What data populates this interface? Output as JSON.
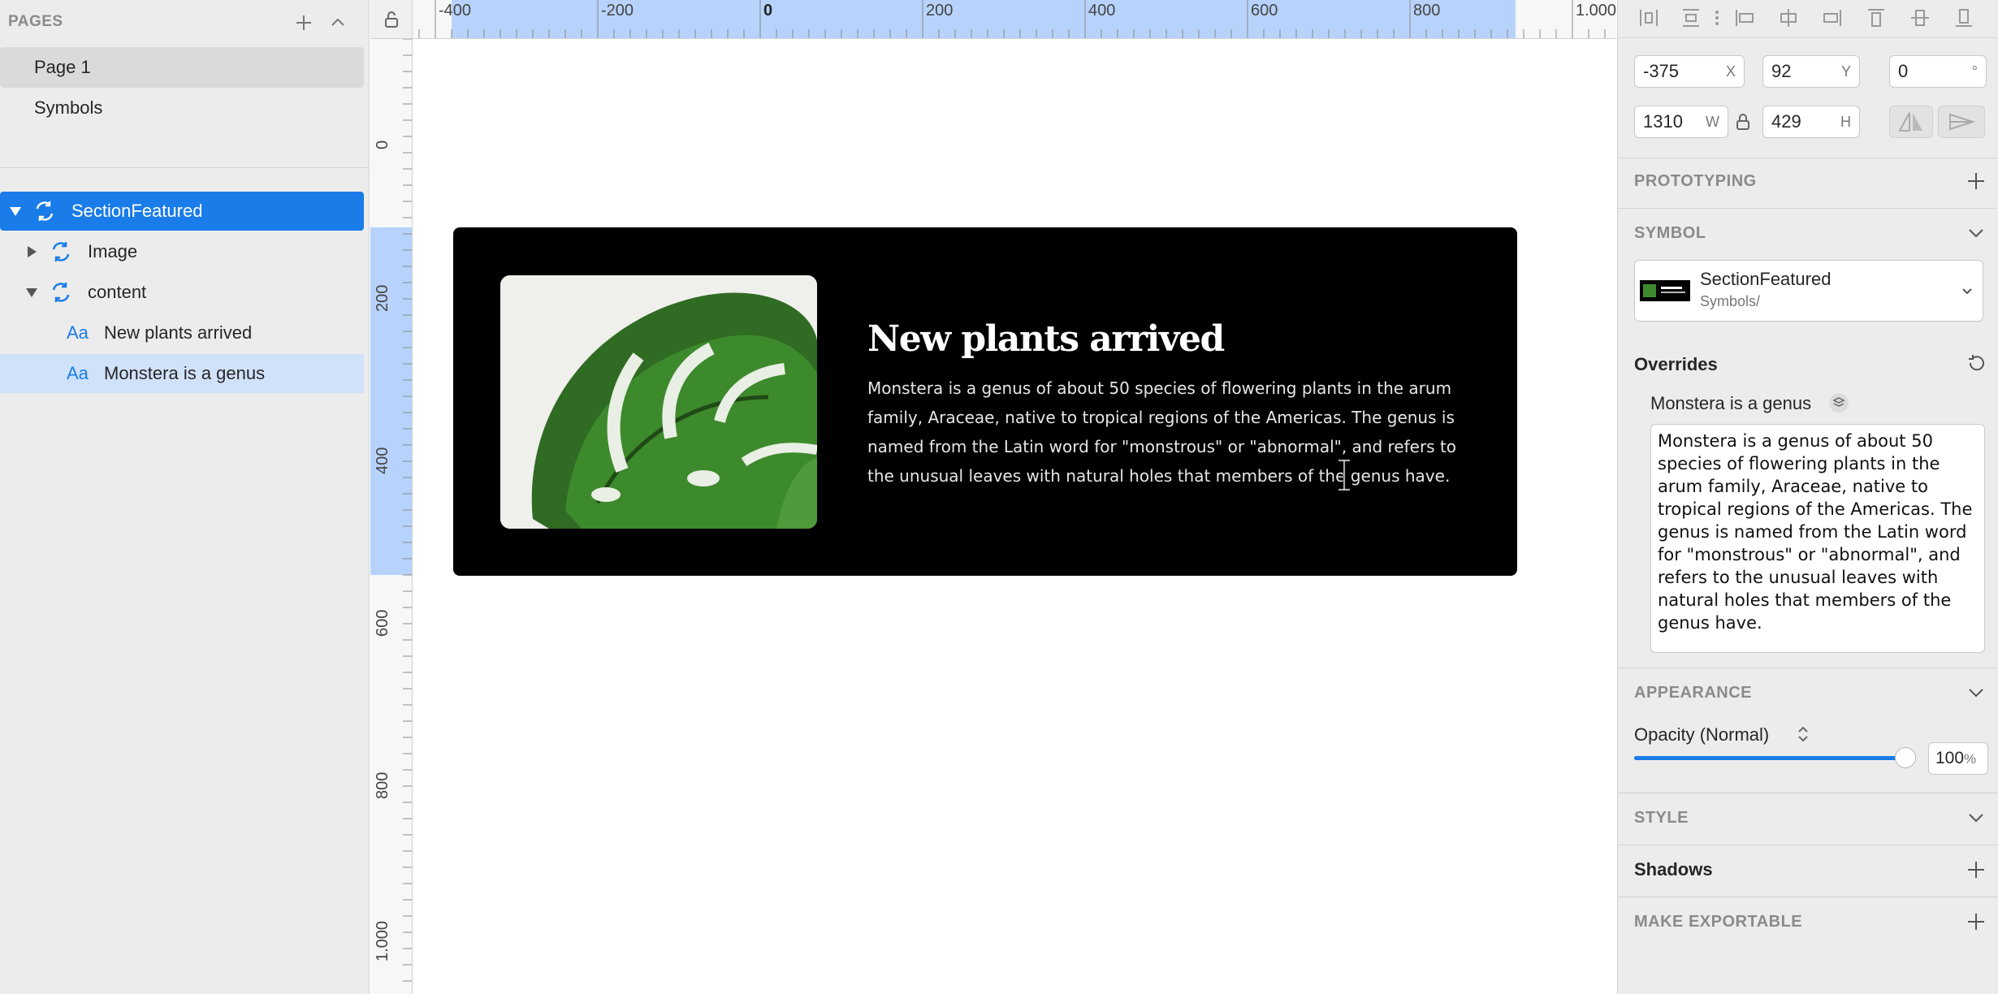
{
  "sidebar": {
    "pages_title": "PAGES",
    "pages": [
      {
        "label": "Page 1"
      },
      {
        "label": "Symbols"
      }
    ],
    "layers": [
      {
        "label": "SectionFeatured"
      },
      {
        "label": "Image"
      },
      {
        "label": "content"
      },
      {
        "label": "New plants arrived",
        "icon_text": "Aa"
      },
      {
        "label": "Monstera is a genus",
        "icon_text": "Aa"
      }
    ]
  },
  "rulers": {
    "top": [
      "-400",
      "-200",
      "0",
      "200",
      "400",
      "600",
      "800",
      "1.000"
    ],
    "left": [
      "0",
      "200",
      "400",
      "600",
      "800",
      "1.000"
    ]
  },
  "artboard": {
    "title": "New plants arrived",
    "body": "Monstera is a genus of about 50 species of flowering plants in the arum family, Araceae, native to tropical regions of the Americas. The genus is named from the Latin word for \"monstrous\" or \"abnormal\", and refers to the unusual leaves with natural holes that members of the genus have."
  },
  "inspector": {
    "x": {
      "value": "-375",
      "suffix": "X"
    },
    "y": {
      "value": "92",
      "suffix": "Y"
    },
    "rotation": {
      "value": "0",
      "suffix": "°"
    },
    "w": {
      "value": "1310",
      "suffix": "W"
    },
    "h": {
      "value": "429",
      "suffix": "H"
    },
    "prototyping_title": "PROTOTYPING",
    "symbol_title": "SYMBOL",
    "symbol_name": "SectionFeatured",
    "symbol_path": "Symbols/",
    "overrides_title": "Overrides",
    "override_label": "Monstera is a genus",
    "override_value": "Monstera is a genus of about 50 species of flowering plants in the arum family, Araceae, native to tropical regions of the Americas. The genus is named from the Latin word for \"monstrous\" or \"abnormal\", and refers to the unusual leaves with natural holes that members of the genus have.",
    "appearance_title": "APPEARANCE",
    "opacity_label": "Opacity (Normal)",
    "opacity_value": "100",
    "opacity_unit": "%",
    "opacity_level": 1.0,
    "style_title": "STYLE",
    "shadows_title": "Shadows",
    "export_title": "MAKE EXPORTABLE"
  },
  "colors": {
    "accent": "#1a7ce8",
    "selection_light": "#d0e2fa",
    "ruler_highlight": "#b7d3fb",
    "artboard_bg": "#000000"
  }
}
